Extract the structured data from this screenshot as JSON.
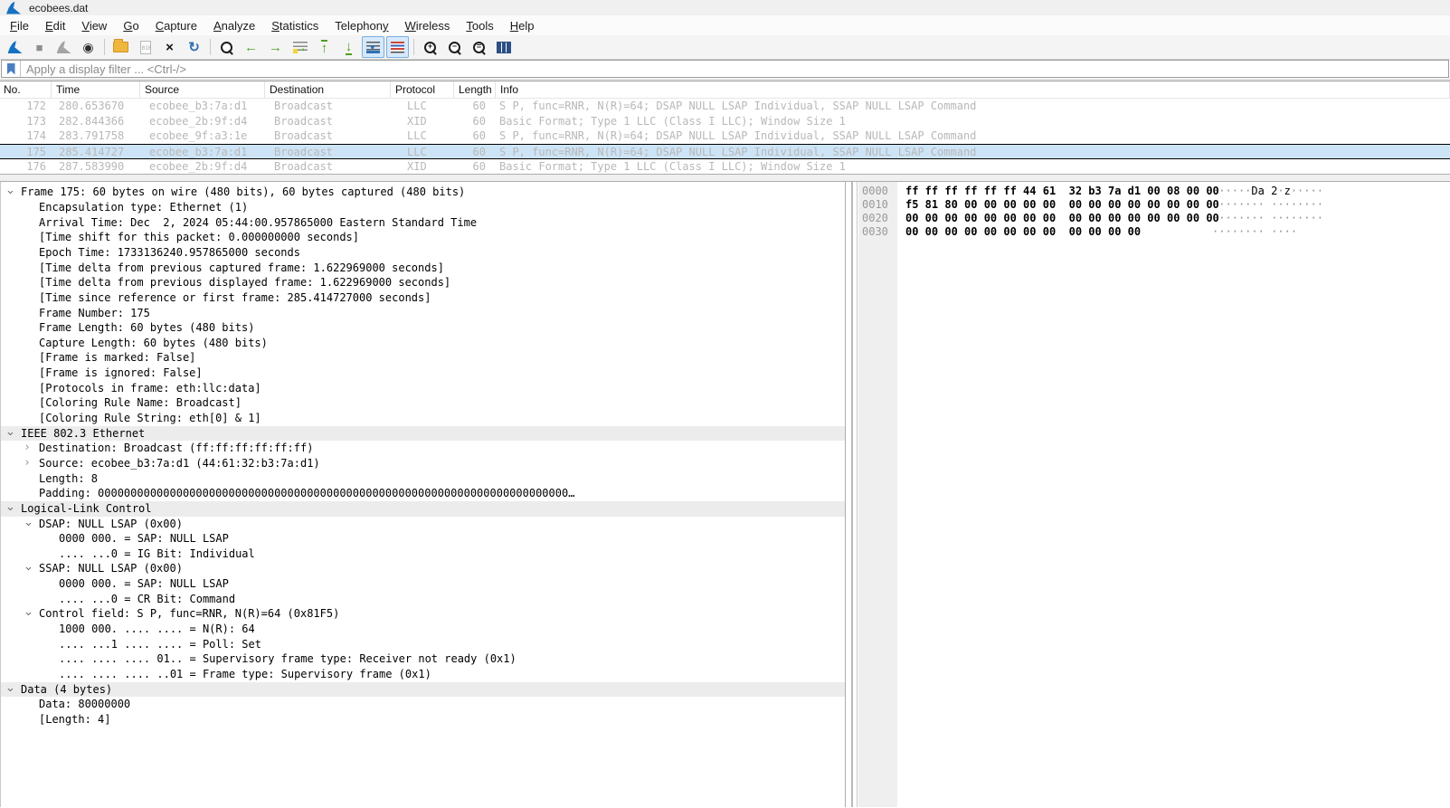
{
  "window": {
    "title": "ecobees.dat"
  },
  "menu": {
    "items": [
      {
        "label": "File",
        "u": 0
      },
      {
        "label": "Edit",
        "u": 0
      },
      {
        "label": "View",
        "u": 0
      },
      {
        "label": "Go",
        "u": 0
      },
      {
        "label": "Capture",
        "u": 0
      },
      {
        "label": "Analyze",
        "u": 0
      },
      {
        "label": "Statistics",
        "u": 0
      },
      {
        "label": "Telephony",
        "u": 8
      },
      {
        "label": "Wireless",
        "u": 0
      },
      {
        "label": "Tools",
        "u": 0
      },
      {
        "label": "Help",
        "u": 0
      }
    ]
  },
  "toolbar": {
    "buttons": [
      {
        "name": "start-capture-icon",
        "kind": "fin"
      },
      {
        "name": "stop-capture-icon",
        "kind": "glyph",
        "glyph": "■",
        "cls": "g-square"
      },
      {
        "name": "restart-capture-icon",
        "kind": "fin-gray"
      },
      {
        "name": "capture-options-icon",
        "kind": "glyph",
        "glyph": "◉",
        "cls": "g-gear"
      },
      {
        "name": "separator",
        "kind": "sep"
      },
      {
        "name": "open-file-icon",
        "kind": "folder"
      },
      {
        "name": "save-file-icon",
        "kind": "doc"
      },
      {
        "name": "close-file-icon",
        "kind": "glyph",
        "glyph": "×",
        "cls": "close-ic"
      },
      {
        "name": "reload-file-icon",
        "kind": "glyph",
        "glyph": "↻",
        "cls": "reload-ic"
      },
      {
        "name": "separator",
        "kind": "sep"
      },
      {
        "name": "find-packet-icon",
        "kind": "mag",
        "sign": ""
      },
      {
        "name": "go-back-icon",
        "kind": "glyph",
        "glyph": "←",
        "cls": "arr"
      },
      {
        "name": "go-forward-icon",
        "kind": "glyph",
        "glyph": "→",
        "cls": "arr"
      },
      {
        "name": "go-to-packet-icon",
        "kind": "goto"
      },
      {
        "name": "go-first-packet-icon",
        "kind": "glyph",
        "glyph": "↑",
        "cls": "arr bar-top"
      },
      {
        "name": "go-last-packet-icon",
        "kind": "glyph",
        "glyph": "↓",
        "cls": "arr bar-bot"
      },
      {
        "name": "auto-scroll-icon",
        "kind": "ascroll",
        "active": true
      },
      {
        "name": "colorize-packets-icon",
        "kind": "colorize",
        "active": true
      },
      {
        "name": "separator",
        "kind": "sep"
      },
      {
        "name": "zoom-in-icon",
        "kind": "mag",
        "sign": "+"
      },
      {
        "name": "zoom-out-icon",
        "kind": "mag",
        "sign": "−"
      },
      {
        "name": "zoom-normal-icon",
        "kind": "mag",
        "sign": "="
      },
      {
        "name": "resize-columns-icon",
        "kind": "rescols"
      }
    ]
  },
  "filter": {
    "placeholder": "Apply a display filter ... <Ctrl-/>"
  },
  "packet_list": {
    "columns": [
      "No.",
      "Time",
      "Source",
      "Destination",
      "Protocol",
      "Length",
      "Info"
    ],
    "rows": [
      {
        "no": "172",
        "time": "280.653670",
        "source": "ecobee_b3:7a:d1",
        "destination": "Broadcast",
        "protocol": "LLC",
        "length": "60",
        "info": "S P, func=RNR, N(R)=64; DSAP NULL LSAP Individual, SSAP NULL LSAP Command",
        "selected": false
      },
      {
        "no": "173",
        "time": "282.844366",
        "source": "ecobee_2b:9f:d4",
        "destination": "Broadcast",
        "protocol": "XID",
        "length": "60",
        "info": "Basic Format; Type 1 LLC (Class I LLC); Window Size 1",
        "selected": false
      },
      {
        "no": "174",
        "time": "283.791758",
        "source": "ecobee_9f:a3:1e",
        "destination": "Broadcast",
        "protocol": "LLC",
        "length": "60",
        "info": "S P, func=RNR, N(R)=64; DSAP NULL LSAP Individual, SSAP NULL LSAP Command",
        "selected": false
      },
      {
        "no": "175",
        "time": "285.414727",
        "source": "ecobee_b3:7a:d1",
        "destination": "Broadcast",
        "protocol": "LLC",
        "length": "60",
        "info": "S P, func=RNR, N(R)=64; DSAP NULL LSAP Individual, SSAP NULL LSAP Command",
        "selected": true
      },
      {
        "no": "176",
        "time": "287.583990",
        "source": "ecobee_2b:9f:d4",
        "destination": "Broadcast",
        "protocol": "XID",
        "length": "60",
        "info": "Basic Format; Type 1 LLC (Class I LLC); Window Size 1",
        "selected": false
      }
    ]
  },
  "details": {
    "lines": [
      {
        "text": "Frame 175: 60 bytes on wire (480 bits), 60 bytes captured (480 bits)",
        "level": 0,
        "arrow": "expanded",
        "gray": false
      },
      {
        "text": "Encapsulation type: Ethernet (1)",
        "level": 1,
        "arrow": null,
        "gray": false
      },
      {
        "text": "Arrival Time: Dec  2, 2024 05:44:00.957865000 Eastern Standard Time",
        "level": 1,
        "arrow": null,
        "gray": false
      },
      {
        "text": "[Time shift for this packet: 0.000000000 seconds]",
        "level": 1,
        "arrow": null,
        "gray": false
      },
      {
        "text": "Epoch Time: 1733136240.957865000 seconds",
        "level": 1,
        "arrow": null,
        "gray": false
      },
      {
        "text": "[Time delta from previous captured frame: 1.622969000 seconds]",
        "level": 1,
        "arrow": null,
        "gray": false
      },
      {
        "text": "[Time delta from previous displayed frame: 1.622969000 seconds]",
        "level": 1,
        "arrow": null,
        "gray": false
      },
      {
        "text": "[Time since reference or first frame: 285.414727000 seconds]",
        "level": 1,
        "arrow": null,
        "gray": false
      },
      {
        "text": "Frame Number: 175",
        "level": 1,
        "arrow": null,
        "gray": false
      },
      {
        "text": "Frame Length: 60 bytes (480 bits)",
        "level": 1,
        "arrow": null,
        "gray": false
      },
      {
        "text": "Capture Length: 60 bytes (480 bits)",
        "level": 1,
        "arrow": null,
        "gray": false
      },
      {
        "text": "[Frame is marked: False]",
        "level": 1,
        "arrow": null,
        "gray": false
      },
      {
        "text": "[Frame is ignored: False]",
        "level": 1,
        "arrow": null,
        "gray": false
      },
      {
        "text": "[Protocols in frame: eth:llc:data]",
        "level": 1,
        "arrow": null,
        "gray": false
      },
      {
        "text": "[Coloring Rule Name: Broadcast]",
        "level": 1,
        "arrow": null,
        "gray": false
      },
      {
        "text": "[Coloring Rule String: eth[0] & 1]",
        "level": 1,
        "arrow": null,
        "gray": false
      },
      {
        "text": "IEEE 802.3 Ethernet",
        "level": 0,
        "arrow": "expanded",
        "gray": true
      },
      {
        "text": "Destination: Broadcast (ff:ff:ff:ff:ff:ff)",
        "level": 1,
        "arrow": "collapsed",
        "gray": false
      },
      {
        "text": "Source: ecobee_b3:7a:d1 (44:61:32:b3:7a:d1)",
        "level": 1,
        "arrow": "collapsed",
        "gray": false
      },
      {
        "text": "Length: 8",
        "level": 1,
        "arrow": null,
        "gray": false
      },
      {
        "text": "Padding: 000000000000000000000000000000000000000000000000000000000000000000000000…",
        "level": 1,
        "arrow": null,
        "gray": false
      },
      {
        "text": "Logical-Link Control",
        "level": 0,
        "arrow": "expanded",
        "gray": true
      },
      {
        "text": "DSAP: NULL LSAP (0x00)",
        "level": 1,
        "arrow": "expanded",
        "gray": false
      },
      {
        "text": "0000 000. = SAP: NULL LSAP",
        "level": 2,
        "arrow": null,
        "gray": false
      },
      {
        "text": ".... ...0 = IG Bit: Individual",
        "level": 2,
        "arrow": null,
        "gray": false
      },
      {
        "text": "SSAP: NULL LSAP (0x00)",
        "level": 1,
        "arrow": "expanded",
        "gray": false
      },
      {
        "text": "0000 000. = SAP: NULL LSAP",
        "level": 2,
        "arrow": null,
        "gray": false
      },
      {
        "text": ".... ...0 = CR Bit: Command",
        "level": 2,
        "arrow": null,
        "gray": false
      },
      {
        "text": "Control field: S P, func=RNR, N(R)=64 (0x81F5)",
        "level": 1,
        "arrow": "expanded",
        "gray": false
      },
      {
        "text": "1000 000. .... .... = N(R): 64",
        "level": 2,
        "arrow": null,
        "gray": false
      },
      {
        "text": ".... ...1 .... .... = Poll: Set",
        "level": 2,
        "arrow": null,
        "gray": false
      },
      {
        "text": ".... .... .... 01.. = Supervisory frame type: Receiver not ready (0x1)",
        "level": 2,
        "arrow": null,
        "gray": false
      },
      {
        "text": ".... .... .... ..01 = Frame type: Supervisory frame (0x1)",
        "level": 2,
        "arrow": null,
        "gray": false
      },
      {
        "text": "Data (4 bytes)",
        "level": 0,
        "arrow": "expanded",
        "gray": true
      },
      {
        "text": "Data: 80000000",
        "level": 1,
        "arrow": null,
        "gray": false
      },
      {
        "text": "[Length: 4]",
        "level": 1,
        "arrow": null,
        "gray": false
      }
    ]
  },
  "hex": {
    "lines": [
      {
        "offset": "0000",
        "bytes": "ff ff ff ff ff ff 44 61  32 b3 7a d1 00 08 00 00",
        "ascii": "······Da 2·z·····"
      },
      {
        "offset": "0010",
        "bytes": "f5 81 80 00 00 00 00 00  00 00 00 00 00 00 00 00",
        "ascii": "········ ········"
      },
      {
        "offset": "0020",
        "bytes": "00 00 00 00 00 00 00 00  00 00 00 00 00 00 00 00",
        "ascii": "········ ········"
      },
      {
        "offset": "0030",
        "bytes": "00 00 00 00 00 00 00 00  00 00 00 00",
        "ascii": "········ ····"
      }
    ]
  },
  "colors": {
    "selection_bg": "#cde4f7",
    "row_text_gray": "#b8b8b8",
    "section_gray": "#ececec",
    "offset_gutter_bg": "#efefef",
    "accent_blue": "#2f71b5",
    "wireshark_fin_blue": "#1571c2",
    "arrow_green": "#4f9f1f",
    "folder_yellow": "#efb73e",
    "active_button_bg": "#d6e9fb"
  }
}
